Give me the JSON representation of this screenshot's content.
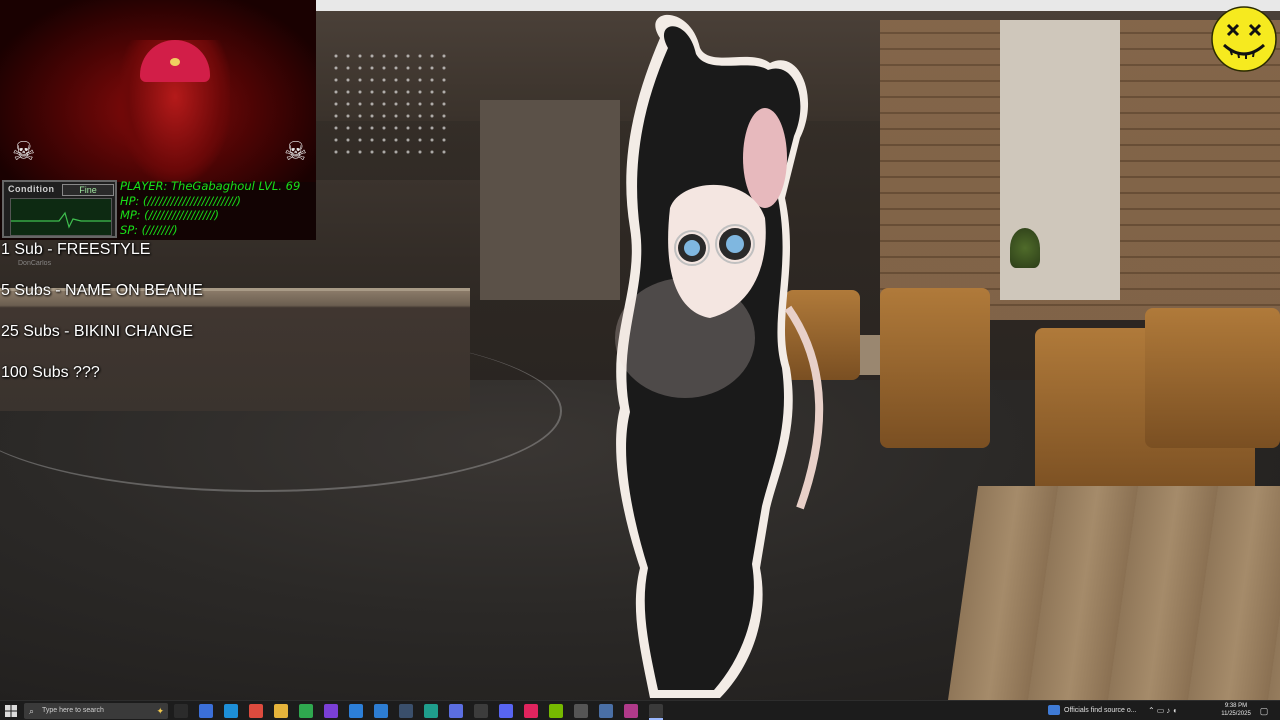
{
  "webcam": {
    "hud_title": "Condition",
    "hud_status": "Fine",
    "stats": {
      "player": "PLAYER: TheGabaghoul LVL. 69",
      "hp": "HP:   (///////////////////////)",
      "mp": "MP:   (/////////////////)",
      "sp": "SP: (///////)"
    }
  },
  "goals": [
    {
      "text": "1 Sub - FREESTYLE"
    },
    {
      "text": "5 Subs - NAME ON BEANIE"
    },
    {
      "text": "25 Subs - BIKINI CHANGE"
    },
    {
      "text": "100 Subs ???"
    }
  ],
  "chat_ghost": {
    "name": "DonCarlos"
  },
  "taskbar": {
    "search_placeholder": "Type here to search",
    "news_text": "Officials find source o...",
    "clock_time": "9:38 PM",
    "clock_date": "11/25/2025",
    "apps": [
      {
        "icon": "task-view-icon",
        "color": "#2b2b2b"
      },
      {
        "icon": "copilot-icon",
        "color": "#3b6fd8"
      },
      {
        "icon": "edge-icon",
        "color": "#1d8fd8"
      },
      {
        "icon": "chrome-icon",
        "color": "#dd4b3e"
      },
      {
        "icon": "file-explorer-icon",
        "color": "#e5b33b"
      },
      {
        "icon": "xbox-icon",
        "color": "#2fa84f"
      },
      {
        "icon": "purple-app-icon",
        "color": "#7a3fd6"
      },
      {
        "icon": "blue-app-icon",
        "color": "#2c7fd8"
      },
      {
        "icon": "vscode-icon",
        "color": "#2d7dd2"
      },
      {
        "icon": "steam-icon",
        "color": "#3a4f6b"
      },
      {
        "icon": "teal-app-icon",
        "color": "#1f9e8c"
      },
      {
        "icon": "vrchat-icon",
        "color": "#5b6ee1"
      },
      {
        "icon": "obs-icon",
        "color": "#3c3c3c"
      },
      {
        "icon": "discord-icon",
        "color": "#5865f2"
      },
      {
        "icon": "tiktok-icon",
        "color": "#e0245e"
      },
      {
        "icon": "nvidia-icon",
        "color": "#76b900"
      },
      {
        "icon": "grey-app-icon",
        "color": "#555555"
      },
      {
        "icon": "settings-icon",
        "color": "#4a6fa5"
      },
      {
        "icon": "pink-app-icon",
        "color": "#b03a8a"
      },
      {
        "icon": "display-app-icon",
        "color": "#3a3a3a"
      }
    ]
  }
}
